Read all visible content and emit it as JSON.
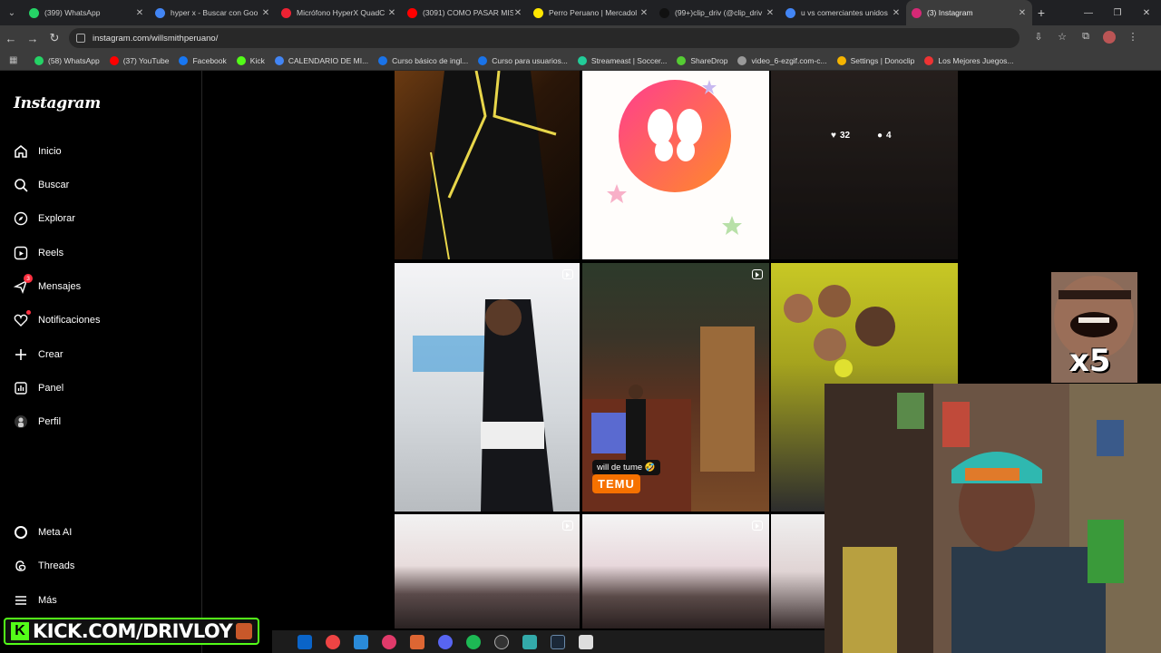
{
  "browser": {
    "tabs": [
      {
        "title": "(399) WhatsApp",
        "color": "#25d366"
      },
      {
        "title": "hyper x - Buscar con Goo",
        "color": "#4285f4"
      },
      {
        "title": "Micrófono HyperX QuadC",
        "color": "#e23"
      },
      {
        "title": "(3091) COMO PASAR MIS",
        "color": "#f00"
      },
      {
        "title": "Perro Peruano | Mercadol",
        "color": "#ffe600"
      },
      {
        "title": "(99+)clip_driv (@clip_driv",
        "color": "#111"
      },
      {
        "title": "u vs comerciantes unidos",
        "color": "#4285f4"
      },
      {
        "title": "(3) Instagram",
        "color": "#d62976",
        "active": true
      }
    ],
    "url": "instagram.com/willsmithperuano/",
    "bookmarks": [
      {
        "label": "(58) WhatsApp",
        "color": "#25d366"
      },
      {
        "label": "(37) YouTube",
        "color": "#f00"
      },
      {
        "label": "Facebook",
        "color": "#1877f2"
      },
      {
        "label": "Kick",
        "color": "#53fc18"
      },
      {
        "label": "CALENDARIO DE MI...",
        "color": "#4285f4"
      },
      {
        "label": "Curso básico de ingl...",
        "color": "#1a73e8"
      },
      {
        "label": "Curso para usuarios...",
        "color": "#1a73e8"
      },
      {
        "label": "Streameast | Soccer...",
        "color": "#2c9"
      },
      {
        "label": "ShareDrop",
        "color": "#5c3"
      },
      {
        "label": "video_6-ezgif.com-c...",
        "color": "#999"
      },
      {
        "label": "Settings | Donoclip",
        "color": "#f5b400"
      },
      {
        "label": "Los Mejores Juegos...",
        "color": "#e33"
      }
    ]
  },
  "sidebar": {
    "logo": "Instagram",
    "items": [
      {
        "label": "Inicio",
        "icon": "home-icon"
      },
      {
        "label": "Buscar",
        "icon": "search-icon"
      },
      {
        "label": "Explorar",
        "icon": "compass-icon"
      },
      {
        "label": "Reels",
        "icon": "reels-icon"
      },
      {
        "label": "Mensajes",
        "icon": "messenger-icon",
        "badge": "3"
      },
      {
        "label": "Notificaciones",
        "icon": "heart-icon"
      },
      {
        "label": "Crear",
        "icon": "plus-icon"
      },
      {
        "label": "Panel",
        "icon": "dashboard-icon"
      },
      {
        "label": "Perfil",
        "icon": "avatar-icon"
      }
    ],
    "bottom_items": [
      {
        "label": "Meta AI",
        "icon": "meta-ai-icon"
      },
      {
        "label": "Threads",
        "icon": "threads-icon"
      },
      {
        "label": "Más",
        "icon": "menu-icon"
      }
    ]
  },
  "grid": {
    "post3_likes": "32",
    "post3_comments": "4",
    "caption": "will de tume 🤣",
    "temu_label": "TEMU"
  },
  "overlay": {
    "kick_url": "KICK.COM/DRIVLOY",
    "meme_multiplier": "x5"
  }
}
